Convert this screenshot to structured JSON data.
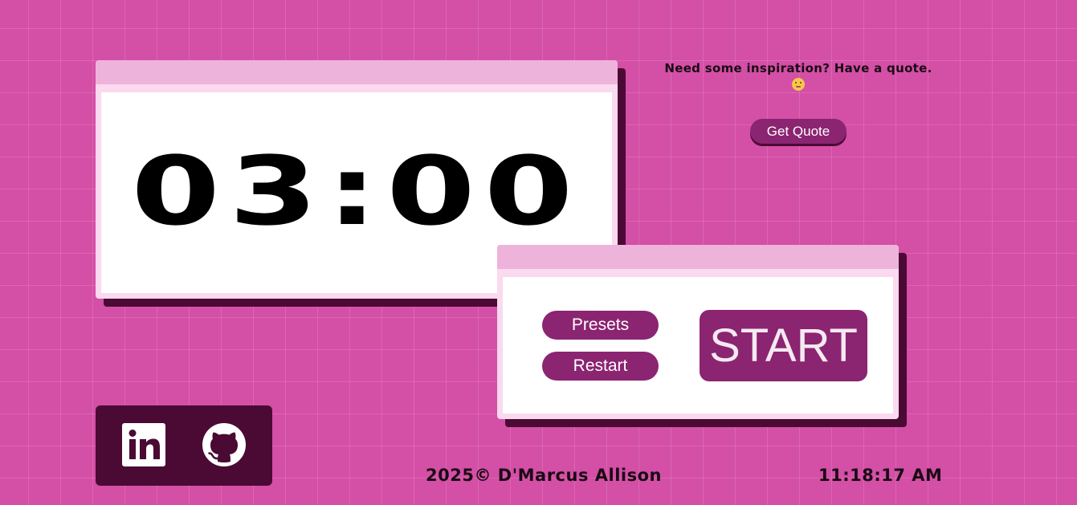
{
  "timer": {
    "display": "03:00"
  },
  "controls": {
    "presets_label": "Presets",
    "restart_label": "Restart",
    "start_label": "START"
  },
  "quote": {
    "prompt": "Need some inspiration? Have a quote.",
    "emoji_icon": "smiling-face-emoji",
    "button_label": "Get Quote"
  },
  "social": {
    "links": [
      {
        "name": "LinkedIn",
        "icon": "linkedin-icon"
      },
      {
        "name": "GitHub",
        "icon": "github-icon"
      }
    ]
  },
  "footer": {
    "credit": "2025© D'Marcus Allison",
    "clock": "11:18:17 AM"
  },
  "colors": {
    "background": "#d44fa6",
    "accent": "#8b2471",
    "dark": "#4a0a34",
    "titlebar": "#eeb3da"
  }
}
